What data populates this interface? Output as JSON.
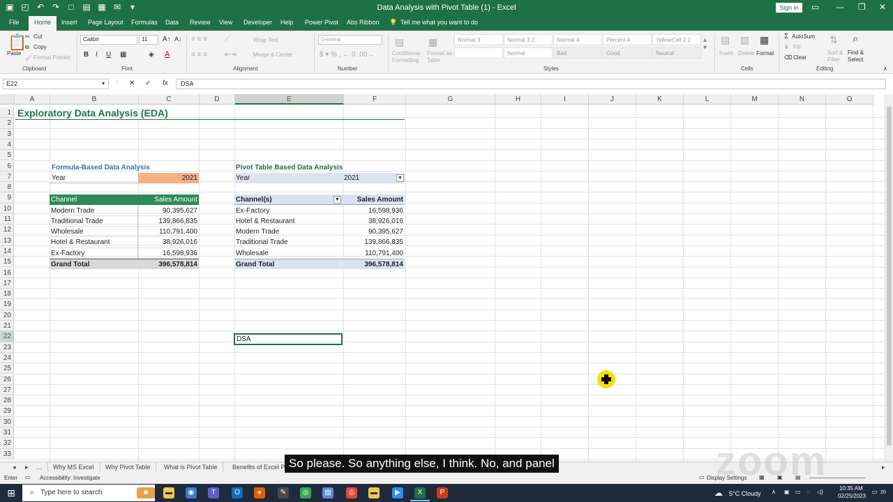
{
  "window": {
    "title": "Data Analysis with Pivot Table (1)  -  Excel",
    "signin": "Sign in"
  },
  "menu": [
    "File",
    "Home",
    "Insert",
    "Page Layout",
    "Formulas",
    "Data",
    "Review",
    "View",
    "Developer",
    "Help",
    "Power Pivot",
    "Abs Ribbon"
  ],
  "tell_me": "Tell me what you want to do",
  "ribbon": {
    "clipboard": {
      "paste": "Paste",
      "cut": "Cut",
      "copy": "Copy",
      "format_painter": "Format Painter",
      "label": "Clipboard"
    },
    "font": {
      "name": "Calibri",
      "size": "11",
      "label": "Font"
    },
    "alignment": {
      "wrap": "Wrap Text",
      "merge": "Merge & Center",
      "label": "Alignment"
    },
    "number": {
      "format": "General",
      "label": "Number"
    },
    "styles": {
      "conditional": "Conditional Formatting",
      "format_as_table": "Format as Table",
      "cells": [
        "Normal 3",
        "Normal 3 2",
        "Normal 4",
        "Percent 4",
        "YellowCell 2 2",
        "",
        "Normal",
        "Bad",
        "Good",
        "Neutral"
      ],
      "label": "Styles"
    },
    "cells": {
      "insert": "Insert",
      "delete": "Delete",
      "format": "Format",
      "label": "Cells"
    },
    "editing": {
      "autosum": "AutoSum",
      "fill": "Fill",
      "clear": "Clear",
      "sort": "Sort & Filter",
      "find": "Find & Select",
      "label": "Editing"
    }
  },
  "formula_bar": {
    "name_box": "E22",
    "value": "DSA"
  },
  "columns": [
    "A",
    "B",
    "C",
    "D",
    "E",
    "F",
    "G",
    "H",
    "I",
    "J",
    "K",
    "L",
    "M",
    "N",
    "O"
  ],
  "rows": [
    "1",
    "2",
    "3",
    "4",
    "5",
    "6",
    "7",
    "8",
    "9",
    "10",
    "11",
    "12",
    "13",
    "14",
    "15",
    "16",
    "17",
    "18",
    "19",
    "20",
    "21",
    "22",
    "23",
    "24",
    "25",
    "26",
    "27",
    "28",
    "29",
    "30",
    "31",
    "32",
    "33"
  ],
  "sheet": {
    "title": "Exploratory Data Analysis (EDA)",
    "formula_section": {
      "heading": "Formula-Based Data Analysis",
      "year_label": "Year",
      "year_value": "2021",
      "header": [
        "Channel",
        "Sales Amount"
      ],
      "rows": [
        [
          "Modern Trade",
          "90,395,627"
        ],
        [
          "Traditional Trade",
          "139,866,835"
        ],
        [
          "Wholesale",
          "110,791,400"
        ],
        [
          "Hotel & Restaurant",
          "38,926,016"
        ],
        [
          "Ex-Factory",
          "16,598,936"
        ]
      ],
      "total": [
        "Grand Total",
        "396,578,814"
      ]
    },
    "pivot_section": {
      "heading": "Pivot Table Based Data Analysis",
      "year_label": "Year",
      "year_value": "2021",
      "header": [
        "Channel(s)",
        "Sales Amount"
      ],
      "rows": [
        [
          "Ex-Factory",
          "16,598,936"
        ],
        [
          "Hotel & Restaurant",
          "38,926,016"
        ],
        [
          "Modern Trade",
          "90,395,627"
        ],
        [
          "Traditional Trade",
          "139,866,835"
        ],
        [
          "Wholesale",
          "110,791,400"
        ]
      ],
      "total": [
        "Grand Total",
        "396,578,814"
      ]
    },
    "active_cell_value": "DSA"
  },
  "sheet_tabs": [
    "...",
    "Why MS Excel",
    "Why Pivot Table",
    "What is Pivot Table",
    "Benefits of Excel Pi"
  ],
  "status": {
    "mode": "Enter",
    "accessibility": "Accessibility: Investigate",
    "display": "Display Settings"
  },
  "taskbar": {
    "search": "Type here to search",
    "weather": "5°C  Cloudy",
    "time": "10:35 AM",
    "date": "02/25/2023",
    "notif": "20"
  },
  "caption": "So please. So anything else, I think. No, and panel",
  "watermark": "zoom",
  "colors": {
    "excel_green": "#1e7145",
    "table_header": "#2e8b57",
    "year_cell": "#f4b183",
    "pivot_header": "#d9e1f2",
    "total_fill": "#d9d9d9",
    "heading_blue": "#2e75b6"
  }
}
